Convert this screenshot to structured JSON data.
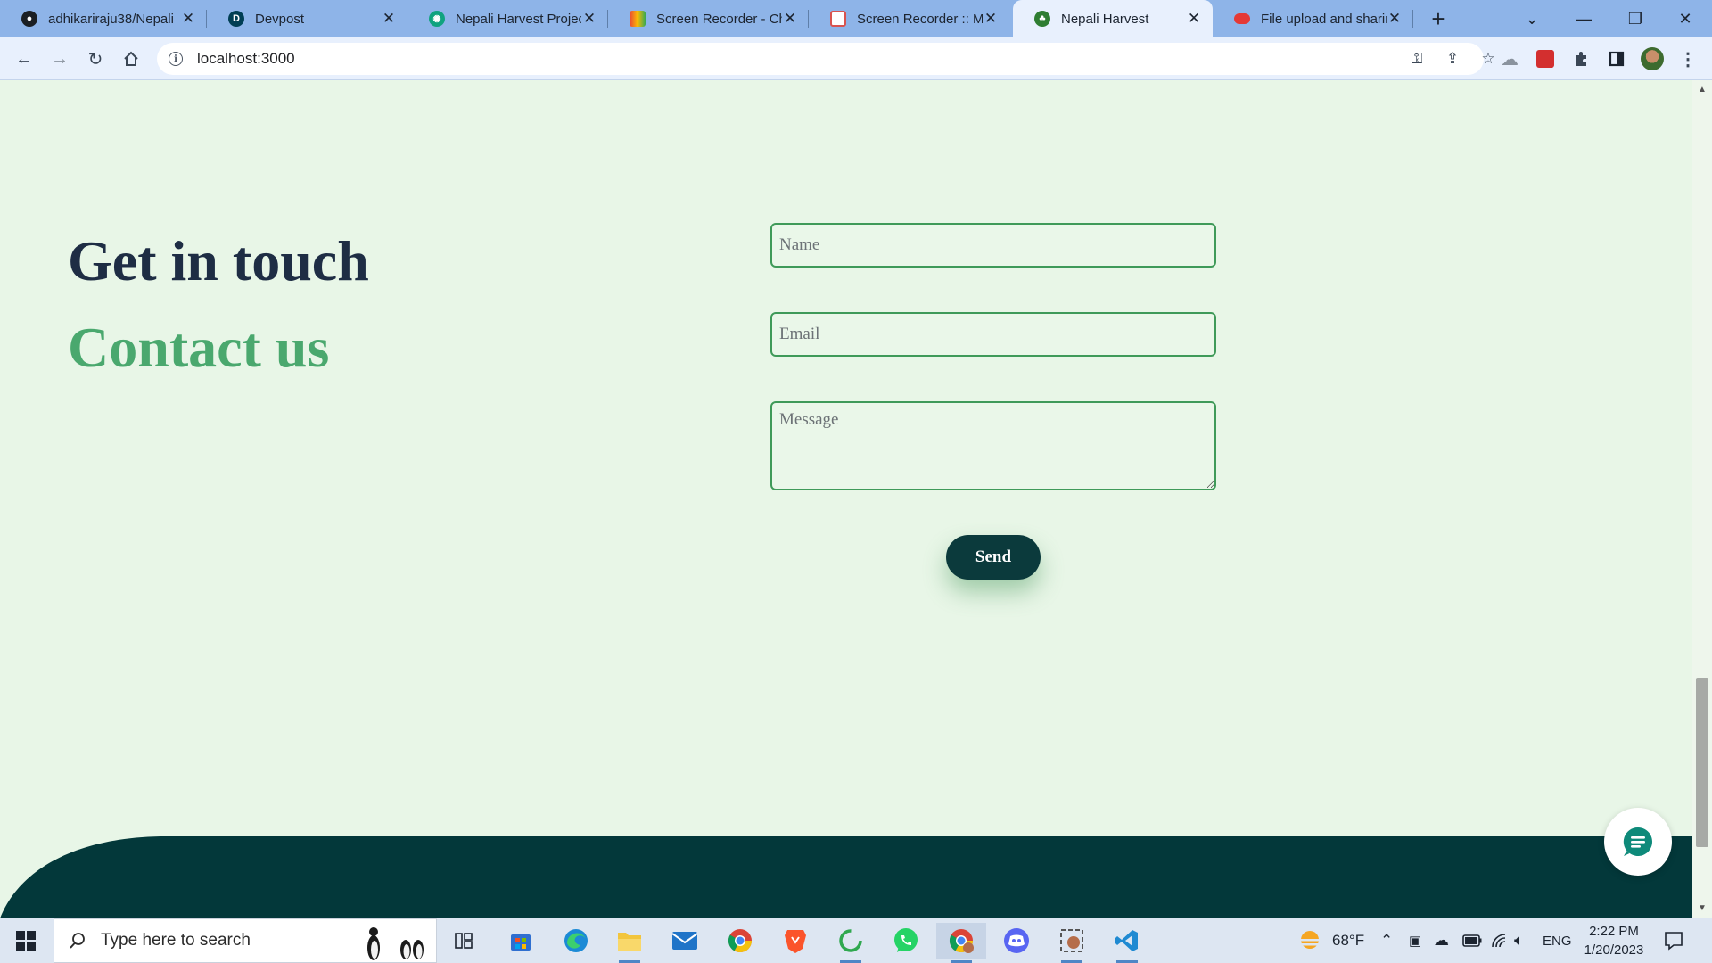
{
  "browser": {
    "tabs": [
      {
        "title": "adhikariraju38/Nepali",
        "icon": "github-icon",
        "active": false
      },
      {
        "title": "Devpost",
        "icon": "devpost-icon",
        "active": false
      },
      {
        "title": "Nepali Harvest Projec",
        "icon": "openai-icon",
        "active": false
      },
      {
        "title": "Screen Recorder - Chr",
        "icon": "chrome-webstore-icon",
        "active": false
      },
      {
        "title": "Screen Recorder :: My",
        "icon": "screen-recorder-icon",
        "active": false
      },
      {
        "title": "Nepali Harvest",
        "icon": "nepali-harvest-icon",
        "active": true
      },
      {
        "title": "File upload and sharir",
        "icon": "file-share-icon",
        "active": false
      }
    ],
    "new_tab": "+",
    "url": "localhost:3000"
  },
  "page": {
    "heading_primary": "Get in touch",
    "heading_secondary": "Contact us",
    "form": {
      "name_placeholder": "Name",
      "email_placeholder": "Email",
      "message_placeholder": "Message",
      "send_label": "Send"
    }
  },
  "taskbar": {
    "search_placeholder": "Type here to search",
    "pinned": [
      "task-view-icon",
      "microsoft-store-icon",
      "edge-icon",
      "file-explorer-icon",
      "mail-icon",
      "chrome-icon",
      "brave-icon",
      "loading-app-icon",
      "whatsapp-icon",
      "chrome-profile-icon",
      "discord-icon",
      "snipping-tool-icon",
      "vscode-icon"
    ],
    "weather": "68°F",
    "language": "ENG",
    "time": "2:22 PM",
    "date": "1/20/2023"
  },
  "colors": {
    "page_background": "#e8f6e7",
    "heading_dark": "#1e2d44",
    "heading_green": "#4aa86e",
    "field_border": "#3f9a59",
    "button_bg": "#0b3a3c",
    "footer_bg": "#03383a",
    "tabstrip_bg": "#8eb4e8"
  }
}
